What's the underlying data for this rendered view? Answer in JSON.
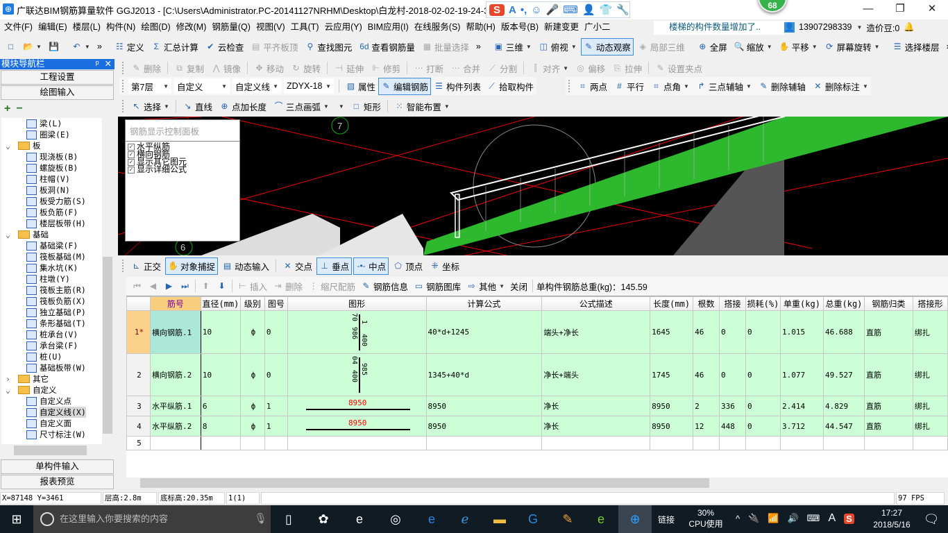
{
  "window": {
    "title": "广联达BIM钢筋算量软件 GGJ2013 - [C:\\Users\\Administrator.PC-20141127NRHM\\Desktop\\白龙村-2018-02-02-19-24-35",
    "badge": "68",
    "ime": [
      "S",
      "A",
      "•,",
      "☺",
      "🎤",
      "⌨",
      "👤",
      "👕",
      "🔧"
    ],
    "min": "—",
    "max": "❐",
    "close": "✕"
  },
  "menu": [
    "文件(F)",
    "编辑(E)",
    "楼层(L)",
    "构件(N)",
    "绘图(D)",
    "修改(M)",
    "钢筋量(Q)",
    "视图(V)",
    "工具(T)",
    "云应用(Y)",
    "BIM应用(I)",
    "在线服务(S)",
    "帮助(H)",
    "版本号(B)",
    "新建变更",
    "广小二"
  ],
  "notice": "楼梯的构件数量增加了..",
  "account": {
    "phone": "13907298339",
    "beans": "造价豆:0"
  },
  "toolbar1": [
    {
      "label": "",
      "icon": "□"
    },
    {
      "label": "",
      "icon": "📂",
      "dd": true
    },
    {
      "label": "",
      "icon": "💾"
    },
    {
      "sep": true
    },
    {
      "label": "",
      "icon": "↶",
      "dd": true
    },
    {
      "label": "»",
      "icon": ""
    },
    {
      "sep": true
    },
    {
      "label": "定义",
      "icon": "☷"
    },
    {
      "label": "汇总计算",
      "icon": "Σ"
    },
    {
      "label": "云检查",
      "icon": "✔"
    },
    {
      "label": "平齐板顶",
      "icon": "▤",
      "dis": true
    },
    {
      "label": "查找图元",
      "icon": "⚲"
    },
    {
      "label": "查看钢筋量",
      "icon": "6d"
    },
    {
      "label": "批量选择",
      "icon": "▦",
      "dis": true
    },
    {
      "label": "»",
      "icon": ""
    },
    {
      "sep": true
    },
    {
      "label": "三维",
      "icon": "▣",
      "dd": true
    },
    {
      "label": "俯视",
      "icon": "◫",
      "dd": true
    },
    {
      "label": "动态观察",
      "icon": "✎",
      "act": true
    },
    {
      "label": "局部三维",
      "icon": "◈",
      "dis": true
    },
    {
      "sep": true
    },
    {
      "label": "全屏",
      "icon": "⊕"
    },
    {
      "label": "缩放",
      "icon": "🔍",
      "dd": true
    },
    {
      "label": "平移",
      "icon": "✋",
      "dd": true
    },
    {
      "label": "屏幕旋转",
      "icon": "⟳",
      "dd": true
    },
    {
      "sep": true
    },
    {
      "label": "选择楼层",
      "icon": "☰"
    },
    {
      "label": "»",
      "icon": ""
    }
  ],
  "toolbar_edit": [
    {
      "label": "删除",
      "icon": "✎",
      "dis": true
    },
    {
      "sep": true
    },
    {
      "label": "复制",
      "icon": "⧉",
      "dis": true
    },
    {
      "label": "镜像",
      "icon": "⋀",
      "dis": true
    },
    {
      "sep": true
    },
    {
      "label": "移动",
      "icon": "✥",
      "dis": true
    },
    {
      "label": "旋转",
      "icon": "↻",
      "dis": true
    },
    {
      "sep": true
    },
    {
      "label": "延伸",
      "icon": "⊣",
      "dis": true
    },
    {
      "label": "修剪",
      "icon": "⊩",
      "dis": true
    },
    {
      "sep": true
    },
    {
      "label": "打断",
      "icon": "⋯",
      "dis": true
    },
    {
      "label": "合并",
      "icon": "⋯",
      "dis": true
    },
    {
      "label": "分割",
      "icon": "⟋",
      "dis": true
    },
    {
      "sep": true
    },
    {
      "label": "对齐",
      "icon": "⫿",
      "dis": true,
      "dd": true
    },
    {
      "label": "偏移",
      "icon": "◎",
      "dis": true
    },
    {
      "label": "拉伸",
      "icon": "⎘",
      "dis": true
    },
    {
      "sep": true
    },
    {
      "label": "设置夹点",
      "icon": "✎",
      "dis": true
    }
  ],
  "selectors": [
    "第7层",
    "自定义",
    "自定义线",
    "ZDYX-18"
  ],
  "toolbar_prop": [
    {
      "label": "属性",
      "icon": "▧"
    },
    {
      "label": "编辑钢筋",
      "icon": "✎",
      "act": true
    },
    {
      "label": "构件列表",
      "icon": "☰"
    },
    {
      "label": "拾取构件",
      "icon": "⟋"
    }
  ],
  "toolbar_axis": [
    {
      "label": "两点",
      "icon": "⌗"
    },
    {
      "label": "平行",
      "icon": "#"
    },
    {
      "label": "点角",
      "icon": "⌗",
      "dd": true
    },
    {
      "label": "三点辅轴",
      "icon": "↱",
      "dd": true
    },
    {
      "label": "删除辅轴",
      "icon": "✎"
    },
    {
      "label": "删除标注",
      "icon": "✕",
      "dd": true
    }
  ],
  "toolbar_draw": [
    {
      "label": "选择",
      "icon": "↖",
      "dd": true
    },
    {
      "sep": true
    },
    {
      "label": "直线",
      "icon": "↘"
    },
    {
      "label": "点加长度",
      "icon": "⊕"
    },
    {
      "label": "三点画弧",
      "icon": "⌒",
      "dd": true
    },
    {
      "label": "            ",
      "icon": "",
      "dd": true
    },
    {
      "label": "矩形",
      "icon": "□"
    },
    {
      "sep": true
    },
    {
      "label": "智能布置",
      "icon": "⁙",
      "dd": true
    }
  ],
  "left_nav": {
    "title": "模块导航栏",
    "pin": "ᵖ",
    "close": "✕",
    "buttons": [
      "工程设置",
      "绘图输入"
    ],
    "bottom_buttons": [
      "单构件输入",
      "报表预览"
    ],
    "tree": [
      {
        "label": "梁(L)",
        "lvl": 2
      },
      {
        "label": "圈梁(E)",
        "lvl": 2
      },
      {
        "label": "板",
        "lvl": 1,
        "folder": true,
        "exp": "⌄"
      },
      {
        "label": "现浇板(B)",
        "lvl": 2
      },
      {
        "label": "螺旋板(B)",
        "lvl": 2
      },
      {
        "label": "柱帽(V)",
        "lvl": 2
      },
      {
        "label": "板洞(N)",
        "lvl": 2
      },
      {
        "label": "板受力筋(S)",
        "lvl": 2
      },
      {
        "label": "板负筋(F)",
        "lvl": 2
      },
      {
        "label": "楼层板带(H)",
        "lvl": 2
      },
      {
        "label": "基础",
        "lvl": 1,
        "folder": true,
        "exp": "⌄"
      },
      {
        "label": "基础梁(F)",
        "lvl": 2
      },
      {
        "label": "筏板基础(M)",
        "lvl": 2
      },
      {
        "label": "集水坑(K)",
        "lvl": 2
      },
      {
        "label": "柱墩(Y)",
        "lvl": 2
      },
      {
        "label": "筏板主筋(R)",
        "lvl": 2
      },
      {
        "label": "筏板负筋(X)",
        "lvl": 2
      },
      {
        "label": "独立基础(P)",
        "lvl": 2
      },
      {
        "label": "条形基础(T)",
        "lvl": 2
      },
      {
        "label": "桩承台(V)",
        "lvl": 2
      },
      {
        "label": "承台梁(F)",
        "lvl": 2
      },
      {
        "label": "桩(U)",
        "lvl": 2
      },
      {
        "label": "基础板带(W)",
        "lvl": 2
      },
      {
        "label": "其它",
        "lvl": 1,
        "folder": true,
        "exp": "›"
      },
      {
        "label": "自定义",
        "lvl": 1,
        "folder": true,
        "exp": "⌄"
      },
      {
        "label": "自定义点",
        "lvl": 2
      },
      {
        "label": "自定义线(X)",
        "lvl": 2,
        "sel": true
      },
      {
        "label": "自定义面",
        "lvl": 2
      },
      {
        "label": "尺寸标注(W)",
        "lvl": 2
      }
    ]
  },
  "viewport": {
    "panel_title": "钢筋显示控制面板",
    "checks": [
      "水平纵筋",
      "横向钢筋",
      "显示其它图元",
      "显示详细公式"
    ],
    "axis_labels": [
      "7",
      "6"
    ]
  },
  "snap_toolbar": [
    {
      "label": "正交",
      "icon": "⊾"
    },
    {
      "label": "对象捕捉",
      "icon": "✋",
      "act": true
    },
    {
      "label": "动态输入",
      "icon": "▤"
    },
    {
      "sep": true
    },
    {
      "label": "交点",
      "icon": "✕"
    },
    {
      "label": "垂点",
      "icon": "⊥",
      "act": true
    },
    {
      "label": "中点",
      "icon": "-•-",
      "act": true
    },
    {
      "label": "顶点",
      "icon": "⬠"
    },
    {
      "label": "坐标",
      "icon": "⁜"
    }
  ],
  "grid_toolbar": [
    {
      "label": "",
      "icon": "⏮",
      "dis": true
    },
    {
      "label": "",
      "icon": "◀",
      "dis": true
    },
    {
      "label": "",
      "icon": "▶"
    },
    {
      "label": "",
      "icon": "⏭"
    },
    {
      "sep": true
    },
    {
      "label": "",
      "icon": "⬆",
      "dis": true
    },
    {
      "label": "",
      "icon": "⬇"
    },
    {
      "sep": true
    },
    {
      "label": "插入",
      "icon": "⊢",
      "dis": true
    },
    {
      "label": "删除",
      "icon": "⇥",
      "dis": true
    },
    {
      "label": "缩尺配筋",
      "icon": "⋮",
      "dis": true
    },
    {
      "label": "钢筋信息",
      "icon": "✎"
    },
    {
      "label": "钢筋图库",
      "icon": "▭"
    },
    {
      "label": "其他",
      "icon": "⇨",
      "dd": true
    },
    {
      "label": "关闭",
      "icon": ""
    },
    {
      "sep": true
    }
  ],
  "total_weight": "单构件钢筋总重(kg)：145.59",
  "rebar_table": {
    "columns": [
      "",
      "筋号",
      "直径(mm)",
      "级别",
      "图号",
      "图形",
      "计算公式",
      "公式描述",
      "长度(mm)",
      "根数",
      "搭接",
      "损耗(%)",
      "单重(kg)",
      "总重(kg)",
      "钢筋归类",
      "搭接形"
    ],
    "rows": [
      {
        "no": "1*",
        "name": "横向钢筋.1",
        "dia": "10",
        "grade": "ф",
        "fig": "0",
        "shape": [
          "70",
          "1",
          "986",
          "400"
        ],
        "formula": "40*d+1245",
        "desc": "端头+净长",
        "len": "1645",
        "count": "46",
        "lap": "0",
        "loss": "0",
        "unit": "1.015",
        "total": "46.688",
        "cat": "直筋",
        "laptype": "绑扎"
      },
      {
        "no": "2",
        "name": "横向钢筋.2",
        "dia": "10",
        "grade": "ф",
        "fig": "0",
        "shape": [
          "04",
          "985",
          "400"
        ],
        "formula": "1345+40*d",
        "desc": "净长+端头",
        "len": "1745",
        "count": "46",
        "lap": "0",
        "loss": "0",
        "unit": "1.077",
        "total": "49.527",
        "cat": "直筋",
        "laptype": "绑扎"
      },
      {
        "no": "3",
        "name": "水平纵筋.1",
        "dia": "6",
        "grade": "ф",
        "fig": "1",
        "shape": [
          "8950"
        ],
        "formula": "8950",
        "desc": "净长",
        "len": "8950",
        "count": "2",
        "lap": "336",
        "loss": "0",
        "unit": "2.414",
        "total": "4.829",
        "cat": "直筋",
        "laptype": "绑扎"
      },
      {
        "no": "4",
        "name": "水平纵筋.2",
        "dia": "8",
        "grade": "ф",
        "fig": "1",
        "shape": [
          "8950"
        ],
        "formula": "8950",
        "desc": "净长",
        "len": "8950",
        "count": "12",
        "lap": "448",
        "loss": "0",
        "unit": "3.712",
        "total": "44.547",
        "cat": "直筋",
        "laptype": "绑扎"
      },
      {
        "no": "5"
      }
    ]
  },
  "status": {
    "coords": "X=87148 Y=3461",
    "floor_h": "层高:2.8m",
    "base_h": "底标高:20.35m",
    "sel": "1(1)",
    "fps": "97 FPS"
  },
  "taskbar": {
    "search": "在这里输入你要搜索的内容",
    "net": "链接",
    "cpu": "30%",
    "cpu_label": "CPU使用",
    "ime": "A",
    "time": "17:27",
    "date": "2018/5/16"
  },
  "colors": {
    "accent": "#1b6ee0",
    "row_fill": "#ccffd6",
    "shape_label": "#ff0000",
    "green_beam": "#2db82d"
  }
}
